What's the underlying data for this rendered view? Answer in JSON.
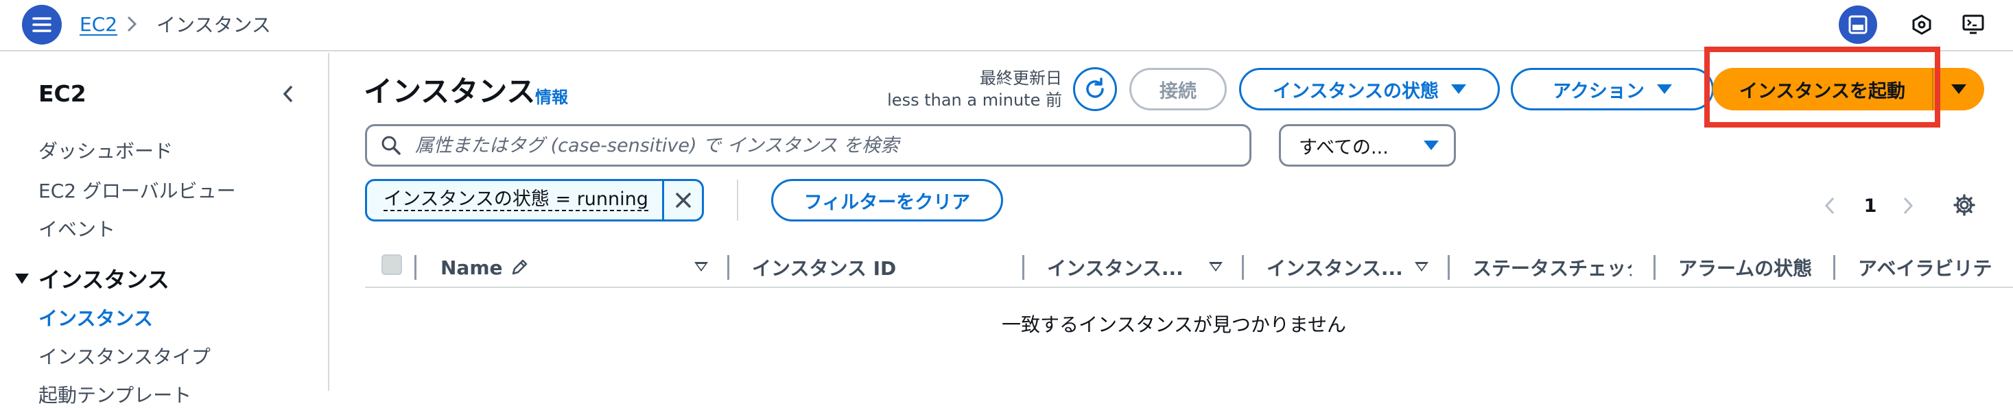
{
  "topbar": {
    "breadcrumb": {
      "service": "EC2",
      "separator": "›",
      "current": "インスタンス"
    }
  },
  "sidebar": {
    "title": "EC2",
    "items": [
      "ダッシュボード",
      "EC2 グローバルビュー",
      "イベント"
    ],
    "section": "インスタンス",
    "section_items": [
      "インスタンス",
      "インスタンスタイプ",
      "起動テンプレート"
    ]
  },
  "header": {
    "title": "インスタンス",
    "info": "情報",
    "last_updated_label": "最終更新日",
    "last_updated_value": "less than a minute 前",
    "connect_label": "接続",
    "instance_state_label": "インスタンスの状態",
    "actions_label": "アクション",
    "launch_label": "インスタンスを起動"
  },
  "search": {
    "placeholder": "属性またはタグ (case-sensitive) で インスタンス を検索",
    "scope_select": "すべての..."
  },
  "filters": {
    "token": "インスタンスの状態 = running",
    "clear_label": "フィルターをクリア"
  },
  "pagination": {
    "current_page": "1"
  },
  "table": {
    "columns": [
      "Name",
      "インスタンス ID",
      "インスタンス...",
      "インスタンス...",
      "ステータスチェック",
      "アラームの状態",
      "アベイラビリテ"
    ],
    "empty_message": "一致するインスタンスが見つかりません"
  },
  "colors": {
    "accent": "#0972d3",
    "launch_button": "#ff9900",
    "highlight_box": "#e8392b",
    "nav_button": "#2b59c3"
  },
  "icons": [
    "menu-icon",
    "chevron-right-icon",
    "panel-icon",
    "hexagon-icon",
    "screen-icon",
    "chevron-left-icon",
    "caret-down-icon",
    "refresh-icon",
    "search-icon",
    "close-icon",
    "settings-icon",
    "pencil-icon"
  ]
}
